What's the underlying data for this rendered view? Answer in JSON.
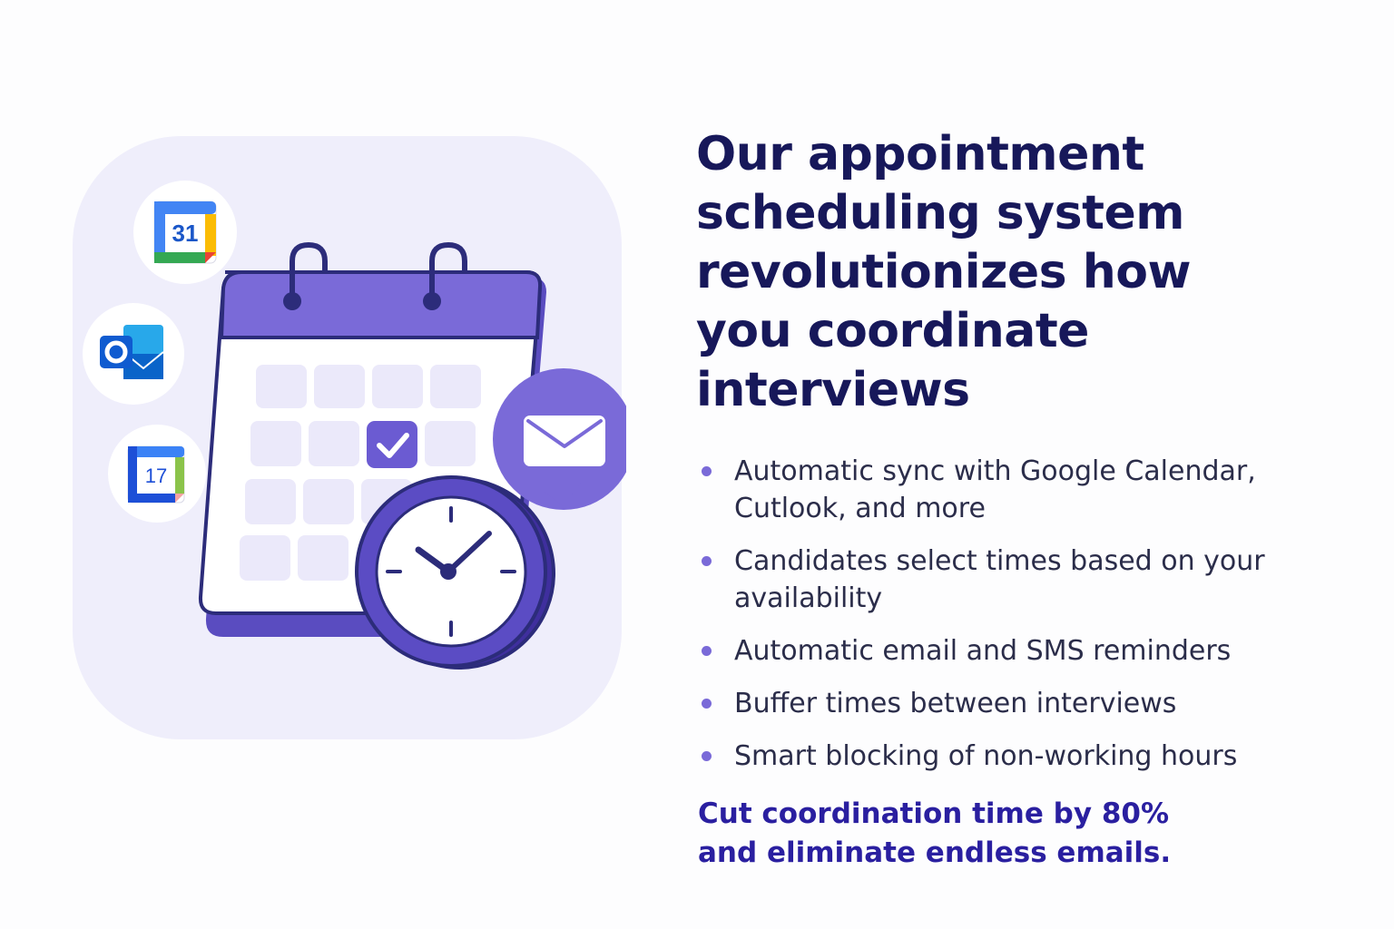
{
  "headline": "Our appointment scheduling system revolutionizes how you coordinate interviews",
  "features": [
    "Automatic sync with Google Calendar, Cutlook, and more",
    "Candidates select times based on your availability",
    "Automatic email and SMS reminders",
    "Buffer times between interviews",
    "Smart blocking of non-working hours"
  ],
  "tagline": {
    "line1": "Cut coordination time by 80%",
    "line2": "and eliminate endless emails."
  },
  "integrations": {
    "google_calendar_day": "31",
    "calendar_app_day": "17"
  },
  "icons": [
    "google-calendar-icon",
    "outlook-icon",
    "calendar-app-icon",
    "calendar-icon",
    "check-icon",
    "envelope-icon",
    "clock-icon"
  ],
  "colors": {
    "accent": "#7a6ad8",
    "headline": "#17185a",
    "tagline": "#2a1fa0",
    "panel": "#efeefb"
  }
}
